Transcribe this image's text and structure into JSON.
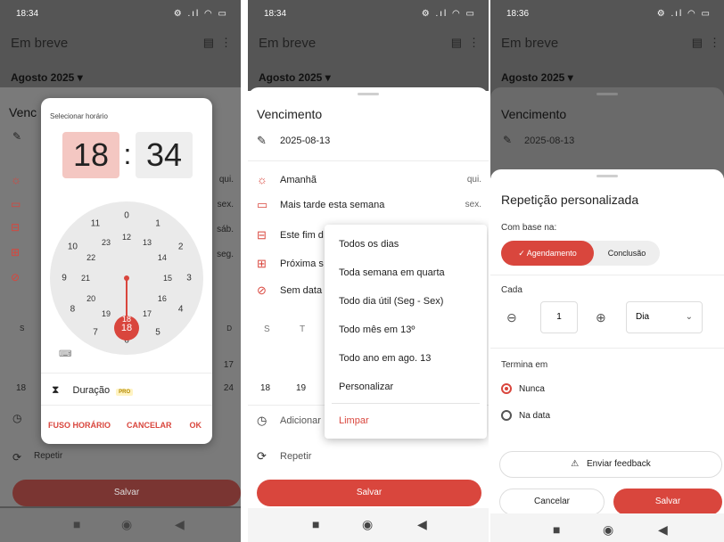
{
  "colors": {
    "accent": "#d9463d",
    "accent_light": "#f4c7c2",
    "overlay": "#555555"
  },
  "panel1": {
    "status_time": "18:34",
    "status_icons": "⚙ .ıl ◠ ▭",
    "app_title": "Em breve",
    "month": "Agosto 2025 ▾",
    "sheet_title_fragment": "Venc",
    "days": [
      "qui.",
      "sex.",
      "sáb.",
      "seg."
    ],
    "weekday_letters": [
      "S",
      "D"
    ],
    "dates": [
      "17",
      "18",
      "24"
    ],
    "dialog": {
      "label": "Selecionar horário",
      "hour": "18",
      "colon": ":",
      "minute": "34",
      "clock_numbers_outer": [
        "0",
        "1",
        "2",
        "3",
        "4",
        "5",
        "6",
        "7",
        "8",
        "9",
        "10",
        "11"
      ],
      "clock_numbers_inner": [
        "12",
        "13",
        "14",
        "15",
        "16",
        "17",
        "18",
        "19",
        "20",
        "21",
        "22",
        "23"
      ],
      "duration_label": "Duração",
      "pro_badge": "PRO",
      "timezone_button": "FUSO HORÁRIO",
      "cancel_button": "CANCELAR",
      "ok_button": "OK"
    },
    "repeat_label": "Repetir",
    "save_label": "Salvar"
  },
  "panel2": {
    "status_time": "18:34",
    "status_icons": "⚙ .ıl ◠ ▭",
    "app_title": "Em breve",
    "month": "Agosto 2025 ▾",
    "sheet_title": "Vencimento",
    "due_date": "2025-08-13",
    "options": [
      {
        "label": "Amanhã",
        "day": "qui."
      },
      {
        "label": "Mais tarde esta semana",
        "day": "sex."
      },
      {
        "label": "Este fim d",
        "day": ""
      },
      {
        "label": "Próxima s",
        "day": ""
      },
      {
        "label": "Sem data",
        "day": ""
      }
    ],
    "weekday_letters": [
      "S",
      "T"
    ],
    "dates": [
      "18",
      "19"
    ],
    "add_label": "Adicionar",
    "repeat_label": "Repetir",
    "save_label": "Salvar",
    "menu": {
      "items": [
        "Todos os dias",
        "Toda semana em quarta",
        "Todo dia útil (Seg - Sex)",
        "Todo mês em 13º",
        "Todo ano em ago. 13",
        "Personalizar"
      ],
      "clear": "Limpar"
    }
  },
  "panel3": {
    "status_time": "18:36",
    "status_icons": "⚙ .ıl ◠ ▭",
    "app_title": "Em breve",
    "month": "Agosto 2025 ▾",
    "sheet_title": "Vencimento",
    "due_date": "2025-08-13",
    "custom": {
      "title": "Repetição personalizada",
      "based_on_label": "Com base na:",
      "toggle_on": "✓ Agendamento",
      "toggle_off": "Conclusão",
      "every_label": "Cada",
      "interval": "1",
      "unit": "Dia",
      "ends_label": "Termina em",
      "never_label": "Nunca",
      "on_date_label": "Na data",
      "feedback_label": "Enviar feedback",
      "cancel_label": "Cancelar",
      "save_label": "Salvar"
    }
  }
}
